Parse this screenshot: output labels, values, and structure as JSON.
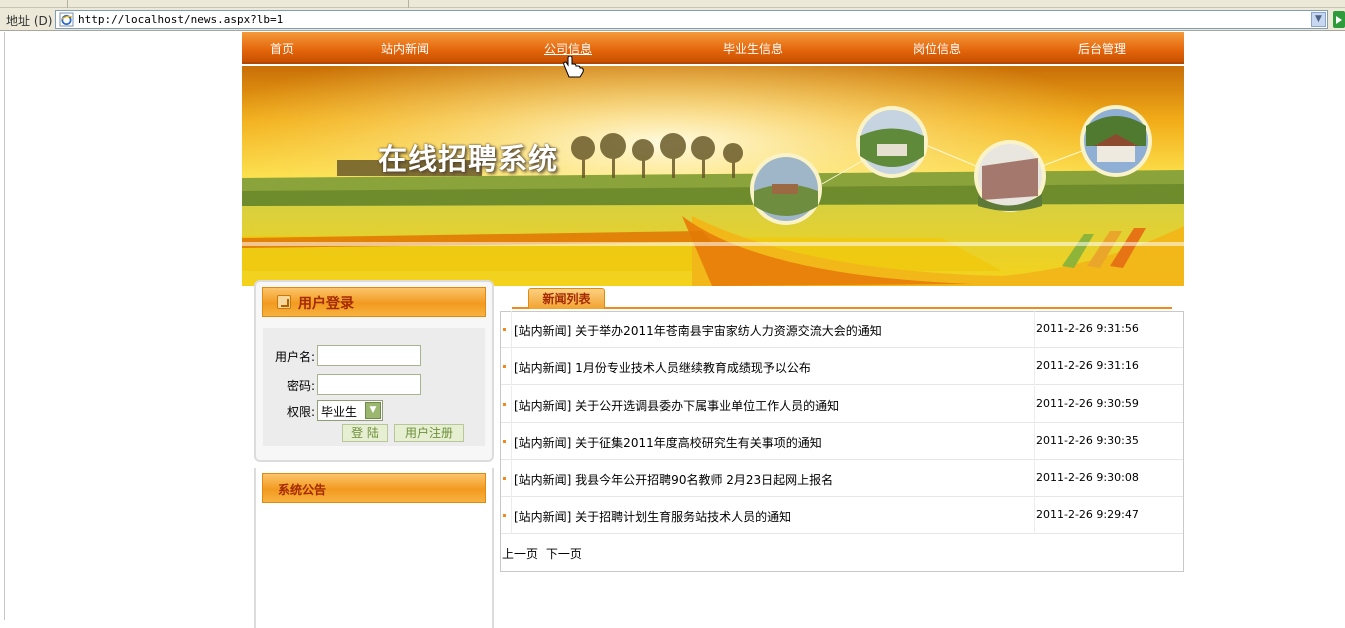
{
  "browser": {
    "address_label": "地址 (D)",
    "url": "http://localhost/news.aspx?lb=1",
    "icons": [
      "ie-page-icon",
      "dropdown-arrow-icon",
      "go-arrow-icon"
    ]
  },
  "nav": {
    "items": [
      {
        "label": "首页"
      },
      {
        "label": "站内新闻"
      },
      {
        "label": "公司信息"
      },
      {
        "label": "毕业生信息"
      },
      {
        "label": "岗位信息"
      },
      {
        "label": "后台管理"
      }
    ],
    "hovered": "公司信息"
  },
  "banner": {
    "title": "在线招聘系统"
  },
  "login": {
    "title": "用户登录",
    "username_label": "用户名:",
    "username_value": "",
    "password_label": "密码:",
    "password_value": "",
    "role_label": "权限:",
    "role_selected": "毕业生",
    "login_button": "登 陆",
    "register_button": "用户注册"
  },
  "notice": {
    "title": "系统公告"
  },
  "news": {
    "tab_label": "新闻列表",
    "rows": [
      {
        "title": "[站内新闻] 关于举办2011年苍南县宇宙家纺人力资源交流大会的通知",
        "time": "2011-2-26 9:31:56"
      },
      {
        "title": "[站内新闻] 1月份专业技术人员继续教育成绩现予以公布",
        "time": "2011-2-26 9:31:16"
      },
      {
        "title": "[站内新闻] 关于公开选调县委办下属事业单位工作人员的通知",
        "time": "2011-2-26 9:30:59"
      },
      {
        "title": "[站内新闻] 关于征集2011年度高校研究生有关事项的通知",
        "time": "2011-2-26 9:30:35"
      },
      {
        "title": "[站内新闻] 我县今年公开招聘90名教师 2月23日起网上报名",
        "time": "2011-2-26 9:30:08"
      },
      {
        "title": "[站内新闻] 关于招聘计划生育服务站技术人员的通知",
        "time": "2011-2-26 9:29:47"
      }
    ],
    "prev_page": "上一页",
    "next_page": "下一页"
  },
  "colors": {
    "nav_orange": "#e4660c",
    "panel_title": "#a52a00",
    "bullet": "#f08a1c"
  }
}
